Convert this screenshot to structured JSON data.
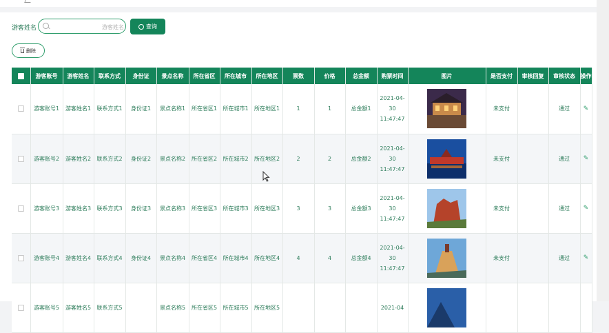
{
  "search": {
    "label": "游客姓名",
    "placeholder": "游客姓名",
    "value": ""
  },
  "buttons": {
    "query": "查询",
    "delete": "删除"
  },
  "table": {
    "headers": [
      "游客账号",
      "游客姓名",
      "联系方式",
      "身份证",
      "景点名称",
      "所在省区",
      "所在城市",
      "所在地区",
      "票数",
      "价格",
      "总金额",
      "购票时间",
      "图片",
      "是否支付",
      "审核回复",
      "审核状态",
      "操作"
    ],
    "rows": [
      {
        "account": "游客账号1",
        "name": "游客姓名1",
        "contact": "联系方式1",
        "idcard": "身份证1",
        "scenic": "景点名称1",
        "province": "所在省区1",
        "city": "所在城市1",
        "district": "所在地区1",
        "tickets": "1",
        "price": "1",
        "total": "总金额1",
        "time": "2021-04-30 11:47:47",
        "paid": "未支付",
        "reply": "",
        "status": "通过",
        "image": "old-town-street"
      },
      {
        "account": "游客账号2",
        "name": "游客姓名2",
        "contact": "联系方式2",
        "idcard": "身份证2",
        "scenic": "景点名称2",
        "province": "所在省区2",
        "city": "所在城市2",
        "district": "所在地区2",
        "tickets": "2",
        "price": "2",
        "total": "总金额2",
        "time": "2021-04-30 11:47:47",
        "paid": "未支付",
        "reply": "",
        "status": "通过",
        "image": "night-water-town"
      },
      {
        "account": "游客账号3",
        "name": "游客姓名3",
        "contact": "联系方式3",
        "idcard": "身份证3",
        "scenic": "景点名称3",
        "province": "所在省区3",
        "city": "所在城市3",
        "district": "所在地区3",
        "tickets": "3",
        "price": "3",
        "total": "总金额3",
        "time": "2021-04-30 11:47:47",
        "paid": "未支付",
        "reply": "",
        "status": "通过",
        "image": "red-rock-formation"
      },
      {
        "account": "游客账号4",
        "name": "游客姓名4",
        "contact": "联系方式4",
        "idcard": "身份证4",
        "scenic": "景点名称4",
        "province": "所在省区4",
        "city": "所在城市4",
        "district": "所在地区4",
        "tickets": "4",
        "price": "4",
        "total": "总金额4",
        "time": "2021-04-30 11:47:47",
        "paid": "未支付",
        "reply": "",
        "status": "通过",
        "image": "cliff-pagoda"
      },
      {
        "account": "游客账号5",
        "name": "游客姓名5",
        "contact": "联系方式5",
        "idcard": "",
        "scenic": "景点名称5",
        "province": "所在省区5",
        "city": "所在城市5",
        "district": "所在地区5",
        "tickets": "",
        "price": "",
        "total": "",
        "time": "2021-04",
        "paid": "",
        "reply": "",
        "status": "",
        "image": "blue-mountain"
      }
    ]
  },
  "colors": {
    "primary": "#14855a",
    "text": "#2e7d5b",
    "stripe": "#f4f6f8"
  },
  "icons": {
    "search": "search-icon",
    "delete": "trash-icon",
    "edit": "edit-icon"
  }
}
